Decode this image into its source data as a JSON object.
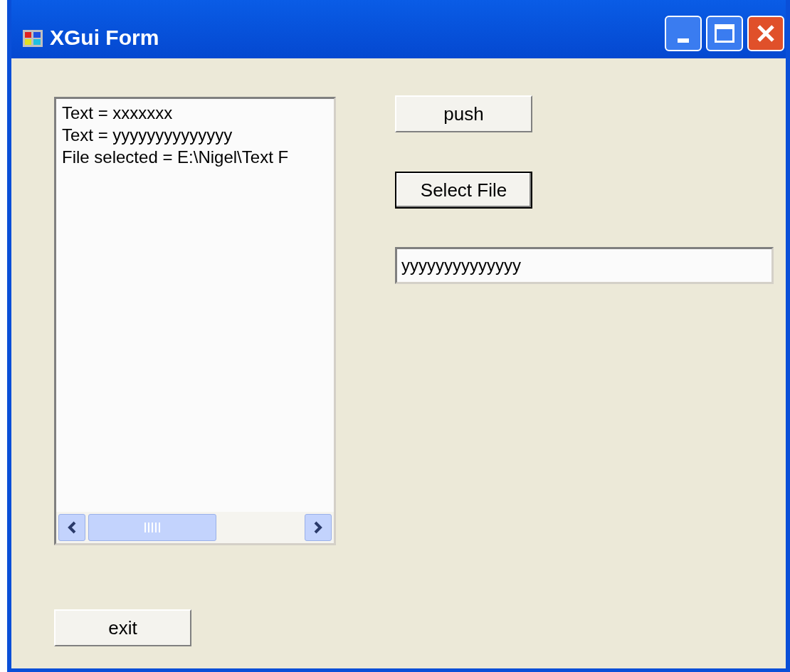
{
  "window": {
    "title": "XGui Form"
  },
  "list": {
    "items": [
      "Text = xxxxxxx",
      "Text = yyyyyyyyyyyyyy",
      "File selected = E:\\Nigel\\Text F"
    ]
  },
  "buttons": [
    {
      "label": "push",
      "focused": false
    },
    {
      "label": "Select File",
      "focused": true
    }
  ],
  "text_field": {
    "value": "yyyyyyyyyyyyyy"
  },
  "exit_button": {
    "label": "exit",
    "focused": false
  }
}
